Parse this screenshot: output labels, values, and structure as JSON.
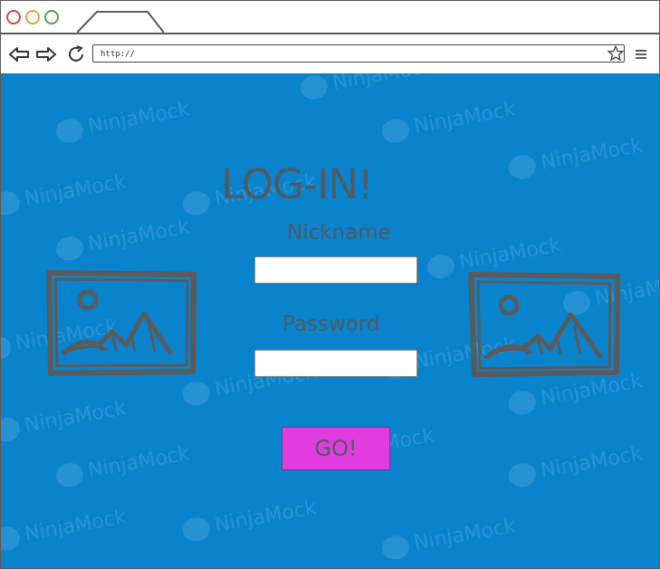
{
  "browser": {
    "url": "http://",
    "window_buttons": [
      "close",
      "minimize",
      "maximize"
    ],
    "icons": [
      "back-arrow-icon",
      "forward-arrow-icon",
      "reload-icon",
      "star-icon",
      "menu-icon"
    ]
  },
  "watermark": "NinjaMock",
  "login": {
    "title": "LOG-IN!",
    "nickname_label": "Nickname",
    "nickname_value": "",
    "password_label": "Password",
    "password_value": "",
    "go_label": "GO!"
  },
  "colors": {
    "background": "#0a83cd",
    "button": "#e03ce0",
    "text": "#4e5b63"
  }
}
